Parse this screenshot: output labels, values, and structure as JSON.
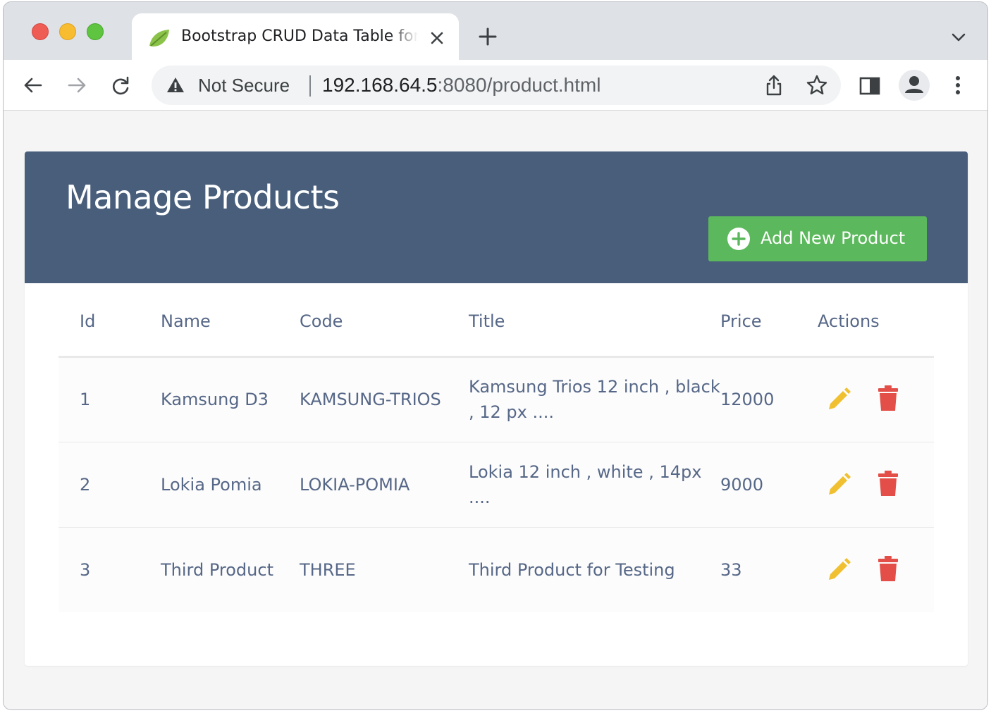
{
  "browser": {
    "tab_title": "Bootstrap CRUD Data Table for",
    "security_label": "Not Secure",
    "url_host": "192.168.64.5",
    "url_rest": ":8080/product.html"
  },
  "page": {
    "title": "Manage Products",
    "add_button_label": "Add New Product"
  },
  "table": {
    "columns": [
      "Id",
      "Name",
      "Code",
      "Title",
      "Price",
      "Actions"
    ],
    "rows": [
      {
        "id": "1",
        "name": "Kamsung D3",
        "code": "KAMSUNG-TRIOS",
        "title": "Kamsung Trios 12 inch , black , 12 px ....",
        "price": "12000"
      },
      {
        "id": "2",
        "name": "Lokia Pomia",
        "code": "LOKIA-POMIA",
        "title": "Lokia 12 inch , white , 14px ....",
        "price": "9000"
      },
      {
        "id": "3",
        "name": "Third Product",
        "code": "THREE",
        "title": "Third Product for Testing",
        "price": "33"
      }
    ]
  },
  "colors": {
    "header_bg": "#485e7b",
    "add_button_bg": "#5cb85c",
    "edit_icon": "#f0c030",
    "delete_icon": "#e34f48",
    "table_text": "#566787"
  },
  "icons": {
    "favicon": "spring-leaf-icon",
    "edit": "pencil-icon",
    "delete": "trash-icon",
    "add": "plus-circle-icon"
  }
}
